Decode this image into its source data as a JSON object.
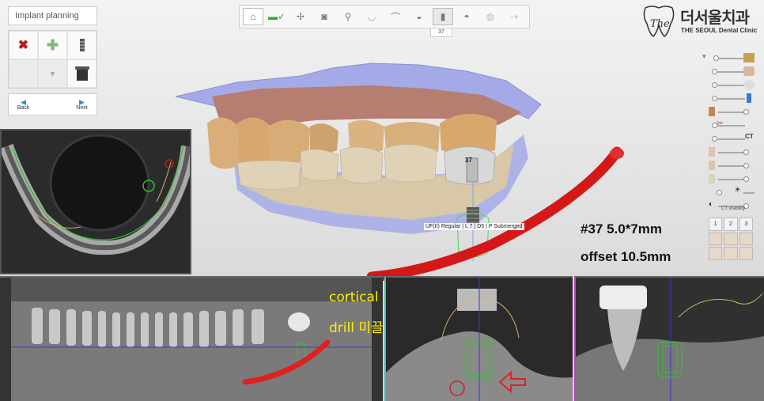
{
  "panel": {
    "title": "Implant planning",
    "back_label": "Back",
    "next_label": "Next"
  },
  "toolbar": {
    "tools": [
      "home",
      "model-check",
      "bone-edit",
      "crown",
      "scan-body",
      "arch",
      "curve",
      "tooth",
      "implant",
      "sleeve",
      "guide",
      "export"
    ],
    "tooth_badge": "37"
  },
  "logo": {
    "korean": "더서울치과",
    "english": "THE SEOUL Dental Clinic"
  },
  "viewer": {
    "implant_spec": "UF(II) Regular | L 7 | D5 | P Submerged",
    "tooth_marker": "37",
    "size_info": "#37 5.0*7mm",
    "offset_info": "offset 10.5mm"
  },
  "annotation": {
    "line1": "cortical bone",
    "line2": "drill 미끌림 주의"
  },
  "sidebar": {
    "ct_label": "CT",
    "ct_visibility_label": "CT visibility",
    "ct_buttons": [
      "1",
      "2",
      "3",
      "",
      "",
      "",
      "",
      "",
      ""
    ]
  },
  "colors": {
    "gingiva": "#b87c6d",
    "teeth": "#d9b58a",
    "scan": "#9fa6e6",
    "drill": "#d41818",
    "guide_green": "#4fd24f",
    "annotation": "#ffee00"
  }
}
